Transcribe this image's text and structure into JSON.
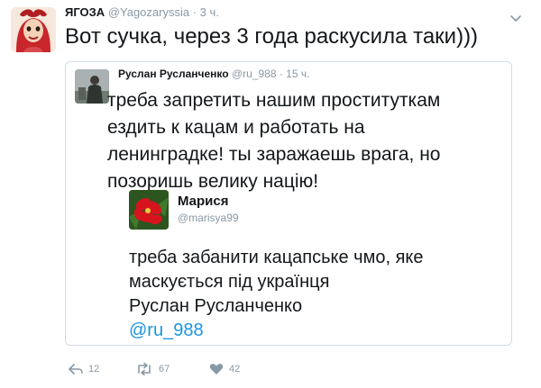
{
  "tweet": {
    "author": {
      "name": "ЯГОЗА",
      "handle": "@Yagozaryssia",
      "time": "· 3 ч."
    },
    "text": "Вот сучка, через 3 года раскусила таки)))"
  },
  "quoted": {
    "author": {
      "name": "Руслан Русланченко",
      "handle": "@ru_988",
      "time": "· 15 ч."
    },
    "text_lines": [
      "треба запретить нашим проституткам",
      "ездить к кацам и работать на",
      "ленинградке! ты заражаешь врага, но",
      "позоришь велику націю!"
    ]
  },
  "nested": {
    "author": {
      "name": "Марися",
      "handle": "@marisya99"
    },
    "text_lines": [
      "треба забанити кацапське чмо, яке",
      "маскується під українця",
      "Руслан Русланченко"
    ],
    "mention": "@ru_988"
  },
  "actions": {
    "replies": "12",
    "retweets": "67",
    "likes": "42"
  },
  "colors": {
    "text": "#14171a",
    "muted": "#8899a6",
    "link": "#1b95e0",
    "border": "#d3dbe2"
  }
}
